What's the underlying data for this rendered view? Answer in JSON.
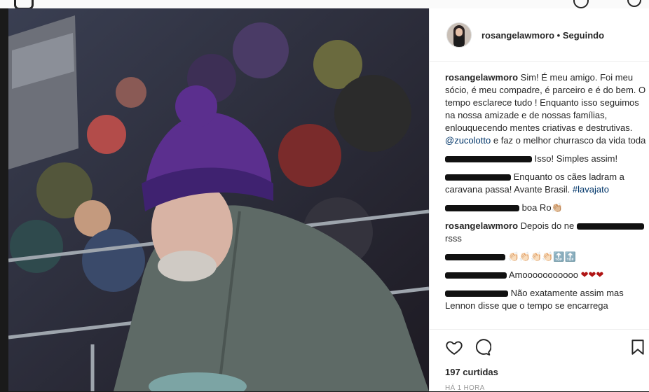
{
  "post": {
    "username": "rosangelawmoro",
    "separator": "•",
    "follow_status": "Seguindo"
  },
  "icons": {
    "like": "heart-icon",
    "comment": "comment-bubble-icon",
    "save": "bookmark-icon",
    "instagram_logo": "instagram-logo-icon",
    "top_right": [
      "compass-icon",
      "profile-icon"
    ]
  },
  "caption": {
    "username": "rosangelawmoro",
    "text_before_mention": "Sim! É meu amigo. Foi meu sócio, é meu compadre, é parceiro e é do bem. O tempo esclarece tudo ! Enquanto isso seguimos na nossa amizade e de nossas famílias, enlouquecendo mentes criativas e destrutivas.",
    "mention": "@zucolotto",
    "text_after_mention": "e faz o melhor churrasco da vida toda"
  },
  "comments": [
    {
      "text": "Isso! Simples assim!"
    },
    {
      "text": "Enquanto os cães ladram a caravana passa! Avante Brasil.",
      "hashtag": "#lavajato"
    },
    {
      "text": "boa Ro👏🏼"
    },
    {
      "username": "rosangelawmoro",
      "text_a": "Depois do ne",
      "text_b": "rsss"
    },
    {
      "text": "👏🏻👏🏻👏🏻👏🏻🔝🔝"
    },
    {
      "text": "Amooooooooooo",
      "hearts": "❤❤❤"
    },
    {
      "text": "Não exatamente assim mas Lennon disse que o tempo se encarrega"
    }
  ],
  "likes_label": "197 curtidas",
  "time_label": "HÁ 1 HORA",
  "colors": {
    "link": "#003569",
    "text": "#262626",
    "muted": "#999999",
    "heart": "#b01414"
  }
}
